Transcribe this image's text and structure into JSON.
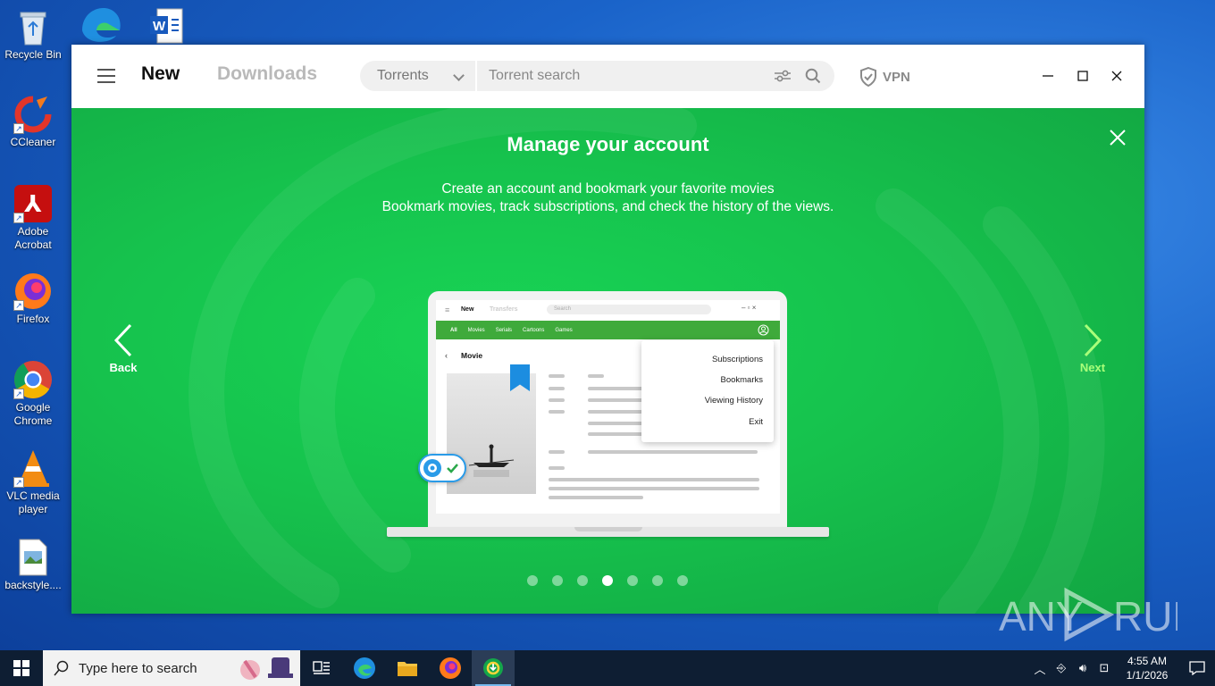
{
  "desktop": {
    "icons": [
      {
        "label": "Recycle Bin",
        "icon": "recycle-bin-icon"
      },
      {
        "label": "CCleaner",
        "icon": "ccleaner-icon"
      },
      {
        "label": "Adobe Acrobat",
        "icon": "adobe-acrobat-icon"
      },
      {
        "label": "Firefox",
        "icon": "firefox-icon"
      },
      {
        "label": "Google Chrome",
        "icon": "chrome-icon"
      },
      {
        "label": "VLC media player",
        "icon": "vlc-icon"
      },
      {
        "label": "backstyle....",
        "icon": "image-file-icon"
      }
    ]
  },
  "app": {
    "nav": {
      "new": "New",
      "downloads": "Downloads"
    },
    "search": {
      "category": "Torrents",
      "placeholder": "Torrent search"
    },
    "vpn_label": "VPN",
    "colors": {
      "accent_green": "#16c24d",
      "next_green": "#a8ff7a"
    }
  },
  "onboarding": {
    "title": "Manage your account",
    "subtitle_line1": "Create an account and bookmark your favorite movies",
    "subtitle_line2": "Bookmark movies, track subscriptions, and check the history of the views.",
    "back_label": "Back",
    "next_label": "Next",
    "total_steps": 7,
    "current_step": 4,
    "illustration": {
      "nav_new": "New",
      "nav_transfers": "Transfers",
      "search_placeholder": "Search",
      "tabs": [
        "All",
        "Movies",
        "Serials",
        "Cartoons",
        "Games"
      ],
      "page_title": "Movie",
      "menu_items": [
        "Subscriptions",
        "Bookmarks",
        "Viewing History",
        "Exit"
      ]
    }
  },
  "watermark": "ANY RUN",
  "taskbar": {
    "search_placeholder": "Type here to search",
    "time": "4:55 AM",
    "date": "1/1/2026"
  }
}
